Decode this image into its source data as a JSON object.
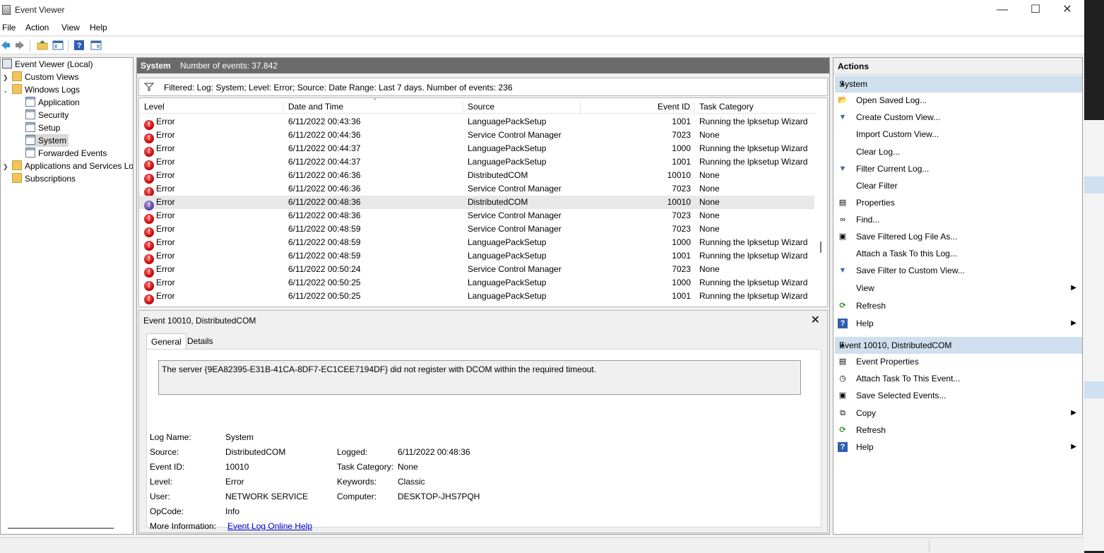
{
  "window": {
    "title": "Event Viewer"
  },
  "menu": [
    "File",
    "Action",
    "View",
    "Help"
  ],
  "tree": {
    "root": "Event Viewer (Local)",
    "custom_views": "Custom Views",
    "windows_logs": "Windows Logs",
    "logs": [
      "Application",
      "Security",
      "Setup",
      "System",
      "Forwarded Events"
    ],
    "apps_services": "Applications and Services Lo",
    "subscriptions": "Subscriptions"
  },
  "center": {
    "log_name": "System",
    "count_text": "Number of events: 37.842",
    "filter_text": "Filtered: Log: System; Level: Error; Source: Date Range: Last 7 days. Number of events: 236",
    "columns": [
      "Level",
      "Date and Time",
      "Source",
      "Event ID",
      "Task Category"
    ],
    "rows": [
      {
        "level": "Error",
        "date": "6/11/2022 00:43:36",
        "source": "LanguagePackSetup",
        "id": "1001",
        "cat": "Running the lpksetup Wizard"
      },
      {
        "level": "Error",
        "date": "6/11/2022 00:44:36",
        "source": "Service Control Manager",
        "id": "7023",
        "cat": "None"
      },
      {
        "level": "Error",
        "date": "6/11/2022 00:44:37",
        "source": "LanguagePackSetup",
        "id": "1000",
        "cat": "Running the lpksetup Wizard"
      },
      {
        "level": "Error",
        "date": "6/11/2022 00:44:37",
        "source": "LanguagePackSetup",
        "id": "1001",
        "cat": "Running the lpksetup Wizard"
      },
      {
        "level": "Error",
        "date": "6/11/2022 00:46:36",
        "source": "DistributedCOM",
        "id": "10010",
        "cat": "None"
      },
      {
        "level": "Error",
        "date": "6/11/2022 00:46:36",
        "source": "Service Control Manager",
        "id": "7023",
        "cat": "None"
      },
      {
        "level": "Error",
        "date": "6/11/2022 00:48:36",
        "source": "DistributedCOM",
        "id": "10010",
        "cat": "None"
      },
      {
        "level": "Error",
        "date": "6/11/2022 00:48:36",
        "source": "Service Control Manager",
        "id": "7023",
        "cat": "None"
      },
      {
        "level": "Error",
        "date": "6/11/2022 00:48:59",
        "source": "Service Control Manager",
        "id": "7023",
        "cat": "None"
      },
      {
        "level": "Error",
        "date": "6/11/2022 00:48:59",
        "source": "LanguagePackSetup",
        "id": "1000",
        "cat": "Running the lpksetup Wizard"
      },
      {
        "level": "Error",
        "date": "6/11/2022 00:48:59",
        "source": "LanguagePackSetup",
        "id": "1001",
        "cat": "Running the lpksetup Wizard"
      },
      {
        "level": "Error",
        "date": "6/11/2022 00:50:24",
        "source": "Service Control Manager",
        "id": "7023",
        "cat": "None"
      },
      {
        "level": "Error",
        "date": "6/11/2022 00:50:25",
        "source": "LanguagePackSetup",
        "id": "1000",
        "cat": "Running the lpksetup Wizard"
      },
      {
        "level": "Error",
        "date": "6/11/2022 00:50:25",
        "source": "LanguagePackSetup",
        "id": "1001",
        "cat": "Running the lpksetup Wizard"
      }
    ]
  },
  "detail": {
    "title": "Event 10010, DistributedCOM",
    "tabs": [
      "General",
      "Details"
    ],
    "description": "The server {9EA82395-E31B-41CA-8DF7-EC1CEE7194DF} did not register with DCOM within the required timeout.",
    "fields": {
      "log_name_label": "Log Name:",
      "log_name": "System",
      "source_label": "Source:",
      "source": "DistributedCOM",
      "logged_label": "Logged:",
      "logged": "6/11/2022 00:48:36",
      "event_id_label": "Event ID:",
      "event_id": "10010",
      "task_cat_label": "Task Category:",
      "task_cat": "None",
      "level_label": "Level:",
      "level": "Error",
      "keywords_label": "Keywords:",
      "keywords": "Classic",
      "user_label": "User:",
      "user": "NETWORK SERVICE",
      "computer_label": "Computer:",
      "computer": "DESKTOP-JHS7PQH",
      "opcode_label": "OpCode:",
      "opcode": "Info",
      "more_info_label": "More Information:",
      "more_info_link": "Event Log Online Help"
    }
  },
  "actions": {
    "header": "Actions",
    "section1": "System",
    "items1": [
      {
        "label": "Open Saved Log...",
        "icon": "open-folder-icon",
        "glyph": "📂"
      },
      {
        "label": "Create Custom View...",
        "icon": "funnel-star-icon",
        "glyph": "▼"
      },
      {
        "label": "Import Custom View...",
        "icon": "",
        "glyph": ""
      },
      {
        "label": "Clear Log...",
        "icon": "",
        "glyph": ""
      },
      {
        "label": "Filter Current Log...",
        "icon": "funnel-icon",
        "glyph": "▼"
      },
      {
        "label": "Clear Filter",
        "icon": "",
        "glyph": ""
      },
      {
        "label": "Properties",
        "icon": "properties-icon",
        "glyph": "▤"
      },
      {
        "label": "Find...",
        "icon": "binoculars-icon",
        "glyph": "∞"
      },
      {
        "label": "Save Filtered Log File As...",
        "icon": "save-icon",
        "glyph": "▣"
      },
      {
        "label": "Attach a Task To this Log...",
        "icon": "",
        "glyph": ""
      },
      {
        "label": "Save Filter to Custom View...",
        "icon": "filter-save-icon",
        "glyph": "▼"
      },
      {
        "label": "View",
        "icon": "",
        "glyph": "",
        "submenu": true
      },
      {
        "label": "Refresh",
        "icon": "refresh-icon",
        "glyph": "⟳"
      },
      {
        "label": "Help",
        "icon": "help-icon",
        "glyph": "?",
        "submenu": true
      }
    ],
    "section2": "Event 10010, DistributedCOM",
    "items2": [
      {
        "label": "Event Properties",
        "icon": "properties-icon",
        "glyph": "▤"
      },
      {
        "label": "Attach Task To This Event...",
        "icon": "task-clock-icon",
        "glyph": "◷"
      },
      {
        "label": "Save Selected Events...",
        "icon": "save-icon",
        "glyph": "▣"
      },
      {
        "label": "Copy",
        "icon": "copy-icon",
        "glyph": "⧉",
        "submenu": true
      },
      {
        "label": "Refresh",
        "icon": "refresh-icon",
        "glyph": "⟳"
      },
      {
        "label": "Help",
        "icon": "help-icon",
        "glyph": "?",
        "submenu": true
      }
    ]
  },
  "colors": {
    "error": "#c00000",
    "section": "#cfdfee",
    "header_dark": "#6b6b6b",
    "link": "#0000cc"
  }
}
